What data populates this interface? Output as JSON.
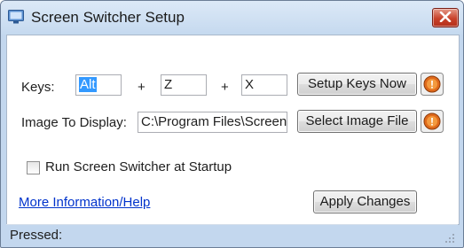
{
  "window": {
    "title": "Screen Switcher Setup"
  },
  "keys": {
    "label": "Keys:",
    "key1": "Alt",
    "plus1": "+",
    "key2": "Z",
    "plus2": "+",
    "key3": "X",
    "setup_button": "Setup Keys Now"
  },
  "image": {
    "label": "Image To Display:",
    "path": "C:\\Program Files\\Screen",
    "select_button": "Select Image File"
  },
  "startup": {
    "checkbox_label": "Run Screen Switcher at Startup",
    "checked": false
  },
  "footer": {
    "help_link": "More Information/Help",
    "apply_button": "Apply Changes"
  },
  "status": {
    "text": "Pressed:"
  },
  "colors": {
    "help_icon": "#e06a1b",
    "close_button": "#c8412a",
    "link": "#0033cc"
  }
}
